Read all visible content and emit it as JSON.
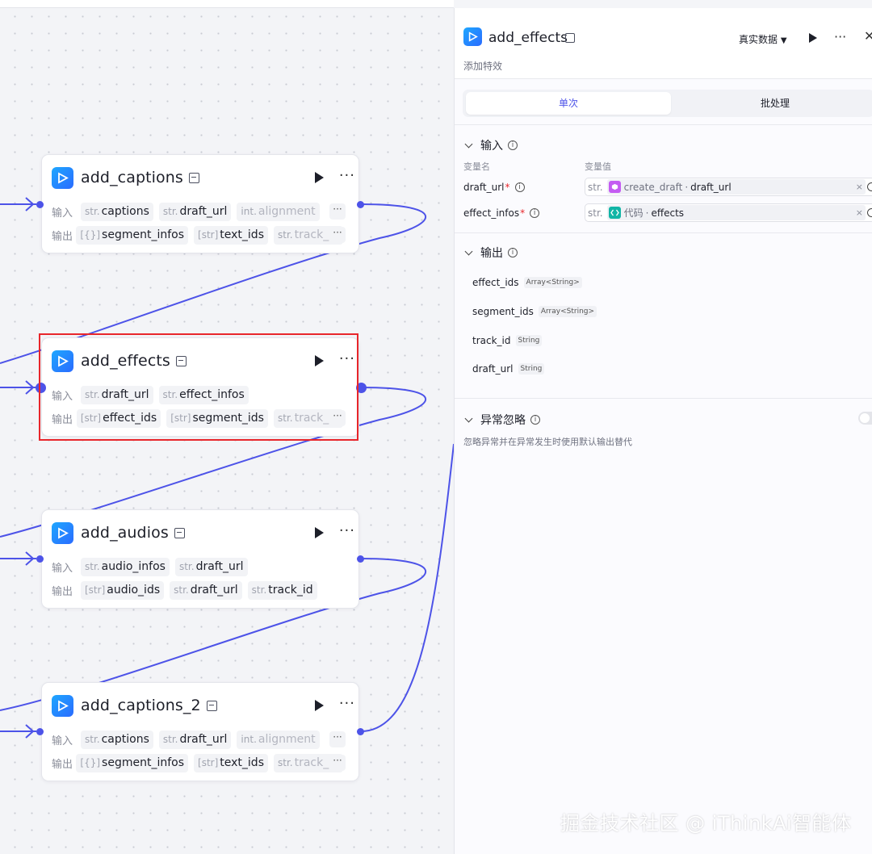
{
  "nodes": [
    {
      "title": "add_captions",
      "inputs": [
        {
          "type": "str.",
          "name": "captions"
        },
        {
          "type": "str.",
          "name": "draft_url"
        },
        {
          "type": "int.",
          "name": "alignment"
        }
      ],
      "outputs": [
        {
          "type": "[{}]",
          "name": "segment_infos"
        },
        {
          "type": "[str]",
          "name": "text_ids"
        },
        {
          "type": "str.",
          "name": "track_id"
        }
      ]
    },
    {
      "title": "add_effects",
      "inputs": [
        {
          "type": "str.",
          "name": "draft_url"
        },
        {
          "type": "str.",
          "name": "effect_infos"
        }
      ],
      "outputs": [
        {
          "type": "[str]",
          "name": "effect_ids"
        },
        {
          "type": "[str]",
          "name": "segment_ids"
        },
        {
          "type": "str.",
          "name": "track_id"
        }
      ]
    },
    {
      "title": "add_audios",
      "inputs": [
        {
          "type": "str.",
          "name": "audio_infos"
        },
        {
          "type": "str.",
          "name": "draft_url"
        }
      ],
      "outputs": [
        {
          "type": "[str]",
          "name": "audio_ids"
        },
        {
          "type": "str.",
          "name": "draft_url"
        },
        {
          "type": "str.",
          "name": "track_id"
        }
      ]
    },
    {
      "title": "add_captions_2",
      "inputs": [
        {
          "type": "str.",
          "name": "captions"
        },
        {
          "type": "str.",
          "name": "draft_url"
        },
        {
          "type": "int.",
          "name": "alignment"
        }
      ],
      "outputs": [
        {
          "type": "[{}]",
          "name": "segment_infos"
        },
        {
          "type": "[str]",
          "name": "text_ids"
        },
        {
          "type": "str.",
          "name": "track_id"
        }
      ]
    }
  ],
  "node_labels": {
    "input": "输入",
    "output": "输出",
    "more": "···"
  },
  "panel": {
    "title": "add_effects",
    "description": "添加特效",
    "mode": "真实数据",
    "tabs": [
      "单次",
      "批处理"
    ],
    "input_section": {
      "title": "输入",
      "col_name": "变量名",
      "col_value": "变量值",
      "params": [
        {
          "name": "draft_url",
          "type": "str.",
          "source": "create_draft",
          "field": "draft_url"
        },
        {
          "name": "effect_infos",
          "type": "str.",
          "source": "代码",
          "field": "effects"
        }
      ]
    },
    "output_section": {
      "title": "输出",
      "items": [
        {
          "name": "effect_ids",
          "type": "Array<String>"
        },
        {
          "name": "segment_ids",
          "type": "Array<String>"
        },
        {
          "name": "track_id",
          "type": "String"
        },
        {
          "name": "draft_url",
          "type": "String"
        }
      ]
    },
    "exception_section": {
      "title": "异常忽略",
      "description": "忽略异常并在异常发生时使用默认输出替代",
      "enabled": false
    }
  },
  "watermark": "掘金技术社区 @ iThinkAi智能体",
  "colors": {
    "edge": "#4d53e8",
    "selection": "#e8262b",
    "accent": "#4d53e8"
  }
}
